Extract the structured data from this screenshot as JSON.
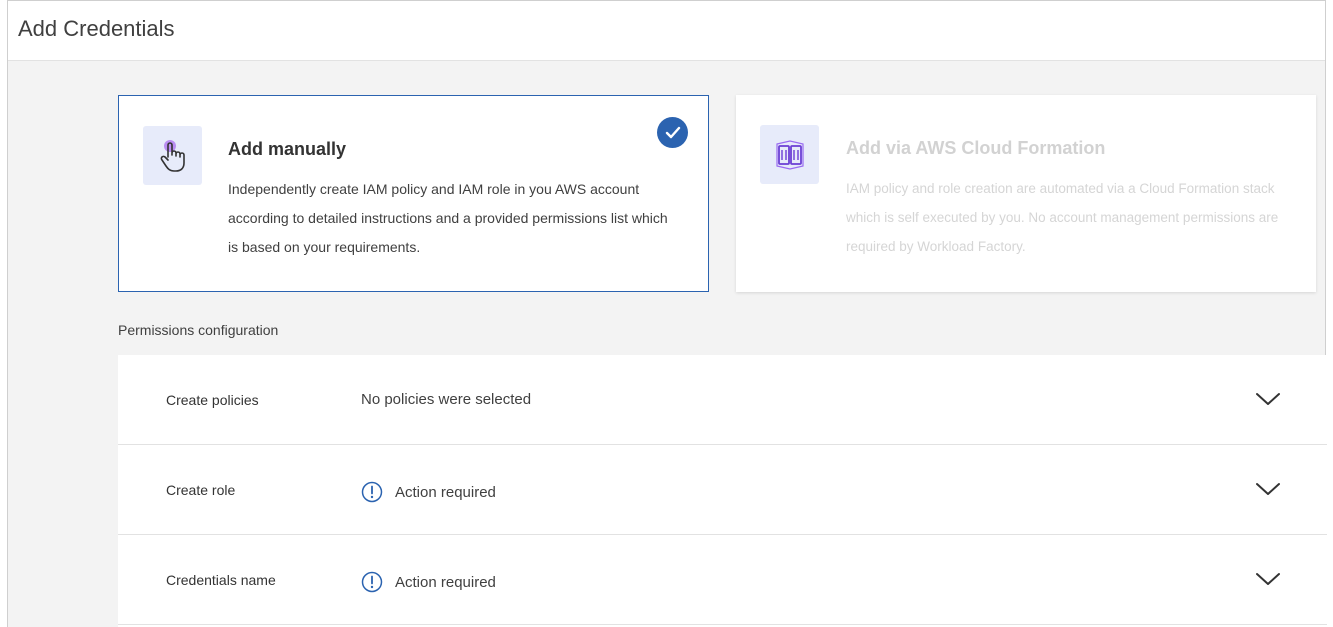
{
  "header": {
    "title": "Add Credentials"
  },
  "options": {
    "manual": {
      "title": "Add manually",
      "description": "Independently create IAM policy and IAM role in you AWS account according to detailed instructions and a provided permissions list which is based on your requirements.",
      "icon": "hand-pointer-icon",
      "selected": true
    },
    "cloudformation": {
      "title": "Add via AWS Cloud Formation",
      "description": "IAM policy and role creation are automated via a Cloud Formation stack which is self executed by you. No account management permissions are required by Workload Factory.",
      "icon": "cloudformation-icon",
      "selected": false
    }
  },
  "permissions": {
    "label": "Permissions configuration",
    "rows": [
      {
        "label": "Create policies",
        "value": "No policies were selected",
        "status": "none"
      },
      {
        "label": "Create role",
        "value": "Action required",
        "status": "action-required"
      },
      {
        "label": "Credentials name",
        "value": "Action required",
        "status": "action-required"
      }
    ]
  },
  "colors": {
    "accent": "#2b63b0",
    "icon_bg": "#e7ebfa",
    "icon_purple": "#7b3fe4"
  }
}
